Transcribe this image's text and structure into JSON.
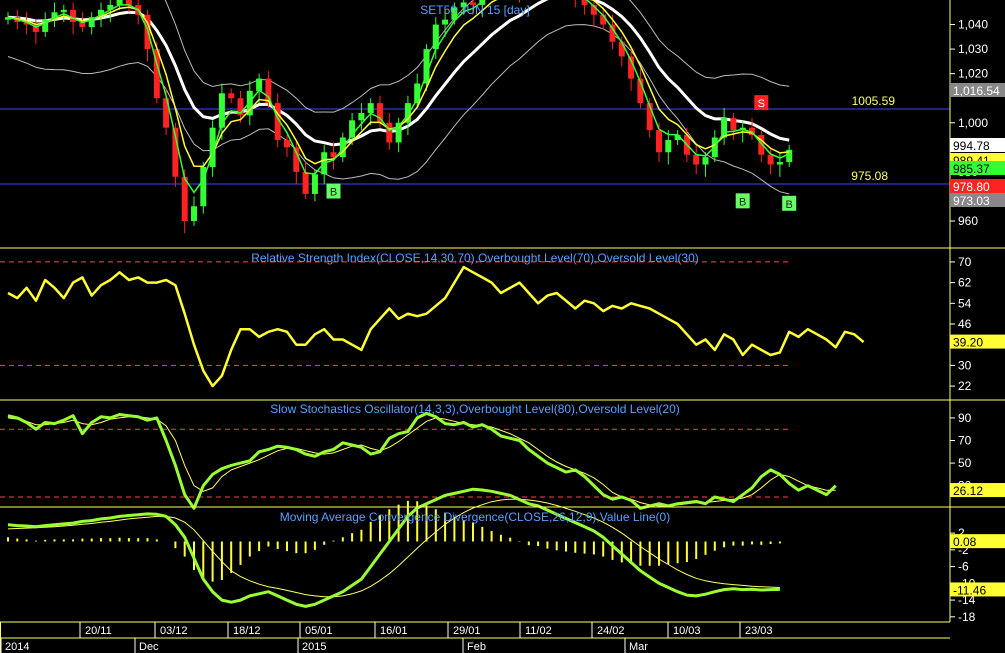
{
  "colors": {
    "background": "#000000",
    "frame": "#ffff66",
    "candle_up": "#33ff33",
    "candle_down": "#ff2222",
    "bollinger_mid": "#ffffff",
    "bollinger_band": "#bbbbbb",
    "ema_fast": "#33ff33",
    "ema_slow": "#ffff33",
    "level_line": "#4444ff",
    "overbought_oversold": "#ff4444",
    "rsi": "#ffff33",
    "stoch_k": "#99ff33",
    "stoch_d": "#ffff66",
    "macd": "#99ff33",
    "macd_signal": "#ffff66",
    "macd_hist": "#ffff33",
    "title_text": "#5aa0ff"
  },
  "chart_data": [
    {
      "type": "candlestick",
      "title": "SET50 JUN 15  [day]",
      "ylim": [
        949,
        1050
      ],
      "y_ticks": [
        960,
        980,
        1000,
        1020,
        1030,
        1040
      ],
      "y_tick_labels": [
        "960",
        "980",
        "1,000",
        "1,020",
        "1,030",
        "1,040"
      ],
      "close": [
        1043,
        1041,
        1040,
        1037,
        1042,
        1045,
        1046,
        1041,
        1039,
        1043,
        1046,
        1048,
        1050,
        1048,
        1044,
        1030,
        1010,
        998,
        978,
        960,
        966,
        982,
        998,
        1012,
        1010,
        1003,
        1013,
        1018,
        1008,
        993,
        990,
        980,
        971,
        979,
        988,
        986,
        994,
        1001,
        1004,
        1008,
        1000,
        992,
        1000,
        1008,
        1016,
        1030,
        1040,
        1042,
        1047,
        1049,
        1048,
        1052,
        1056,
        1055,
        1058,
        1054,
        1060,
        1062,
        1061,
        1056,
        1057,
        1050,
        1048,
        1044,
        1040,
        1033,
        1027,
        1018,
        1008,
        997,
        988,
        993,
        995,
        987,
        983,
        986,
        994,
        1002,
        997,
        998,
        995,
        987,
        983,
        984,
        989
      ],
      "levels": [
        {
          "value": 1005.59,
          "label": "1005.59"
        },
        {
          "value": 975.08,
          "label": "975.08"
        }
      ],
      "price_badges": [
        {
          "value": "1,016.54",
          "color": "#888888"
        },
        {
          "value": "994.78",
          "color": "#ffffff"
        },
        {
          "value": "989.41",
          "color": "#ffff33"
        },
        {
          "value": "985.37",
          "color": "#33ff33"
        },
        {
          "value": "978.80",
          "color": "#ff2222"
        },
        {
          "value": "973.03",
          "color": "#888888"
        }
      ],
      "signals": [
        {
          "label": "B",
          "kind": "buy",
          "bar": 35,
          "price": 972
        },
        {
          "label": "B",
          "kind": "buy",
          "bar": 79,
          "price": 968
        },
        {
          "label": "B",
          "kind": "buy",
          "bar": 84,
          "price": 967
        },
        {
          "label": "S",
          "kind": "sell",
          "bar": 81,
          "price": 1008
        }
      ]
    },
    {
      "type": "line",
      "title": "Relative Strength Index(CLOSE,14,30,70),Overbought Level(70),Oversold Level(30)",
      "ylim": [
        17,
        75
      ],
      "y_ticks": [
        70,
        62,
        54,
        46,
        38,
        30,
        22
      ],
      "overbought": 70,
      "oversold": 30,
      "current_value": "39.20",
      "series": [
        {
          "values": [
            58,
            56,
            60,
            55,
            63,
            60,
            56,
            62,
            64,
            57,
            61,
            63,
            66,
            63,
            64,
            62,
            62,
            63,
            61,
            50,
            38,
            28,
            22,
            26,
            36,
            44,
            44,
            41,
            43,
            44,
            43,
            38,
            38,
            42,
            44,
            40,
            40,
            38,
            36,
            44,
            48,
            52,
            48,
            50,
            49,
            50,
            53,
            56,
            62,
            68,
            66,
            64,
            62,
            58,
            60,
            62,
            58,
            54,
            57,
            58,
            55,
            52,
            55,
            54,
            51,
            53,
            52,
            54,
            53,
            52,
            50,
            48,
            46,
            42,
            38,
            40,
            36,
            42,
            40,
            34,
            38,
            36,
            34,
            35,
            43,
            41,
            44,
            42,
            40,
            37,
            43,
            42,
            39
          ]
        }
      ]
    },
    {
      "type": "line",
      "title": "Slow Stochastics Oscillator(14,3,3),Overbought Level(80),Oversold Level(20)",
      "ylim": [
        12,
        105
      ],
      "y_ticks": [
        90,
        70,
        50,
        30
      ],
      "overbought": 80,
      "oversold": 20,
      "current_value": "26.12",
      "series": [
        {
          "name": "%K",
          "values": [
            92,
            90,
            86,
            80,
            86,
            85,
            88,
            92,
            76,
            86,
            91,
            90,
            93,
            92,
            91,
            88,
            90,
            70,
            48,
            22,
            10,
            30,
            40,
            45,
            48,
            50,
            52,
            60,
            62,
            65,
            64,
            62,
            58,
            56,
            60,
            62,
            68,
            66,
            64,
            58,
            60,
            72,
            76,
            78,
            90,
            94,
            91,
            85,
            84,
            86,
            82,
            84,
            80,
            74,
            72,
            70,
            62,
            56,
            50,
            46,
            42,
            44,
            38,
            30,
            22,
            18,
            20,
            17,
            10,
            12,
            14,
            12,
            14,
            15,
            16,
            14,
            20,
            18,
            16,
            22,
            28,
            38,
            44,
            40,
            32,
            26,
            30,
            26,
            22,
            30
          ]
        },
        {
          "name": "%D",
          "values": [
            90,
            89,
            87,
            84,
            84,
            85,
            86,
            88,
            85,
            84,
            86,
            89,
            90,
            91,
            91,
            90,
            89,
            83,
            70,
            48,
            30,
            25,
            28,
            38,
            44,
            47,
            50,
            53,
            57,
            61,
            63,
            63,
            61,
            59,
            58,
            59,
            62,
            65,
            66,
            63,
            61,
            64,
            69,
            75,
            81,
            87,
            90,
            89,
            87,
            85,
            84,
            83,
            82,
            79,
            76,
            72,
            68,
            62,
            56,
            51,
            47,
            44,
            41,
            37,
            31,
            24,
            20,
            18,
            15,
            13,
            12,
            12,
            13,
            14,
            15,
            15,
            16,
            17,
            18,
            19,
            22,
            28,
            35,
            40,
            38,
            34,
            30,
            28,
            26,
            26
          ]
        }
      ]
    },
    {
      "type": "bar",
      "title": "Moving Average Convergence Divergence(CLOSE,26,12,9),Value Line(0)",
      "ylim": [
        -19,
        8
      ],
      "y_ticks": [
        2,
        -2,
        -6,
        -10,
        -14,
        -18
      ],
      "current_values": [
        "0.08",
        "-11.46"
      ],
      "series": [
        {
          "name": "MACD",
          "values": [
            4,
            3.8,
            3.7,
            3.5,
            3.8,
            4,
            4.2,
            4.4,
            4.8,
            5,
            5.4,
            5.6,
            6,
            6.2,
            6.4,
            6.6,
            6.5,
            6,
            4,
            1,
            -4,
            -9,
            -12,
            -14,
            -14.5,
            -14,
            -13,
            -12.5,
            -12,
            -13,
            -14,
            -15,
            -15.5,
            -15,
            -14,
            -13,
            -12,
            -10.5,
            -9,
            -6,
            -3,
            0,
            3,
            6,
            8,
            9,
            10,
            11,
            11.5,
            12,
            12.5,
            12.3,
            12,
            11.5,
            11,
            10,
            9,
            8.5,
            7.5,
            6.5,
            5.5,
            4.5,
            3.5,
            2.5,
            1,
            -1,
            -3,
            -5,
            -7,
            -8.5,
            -10,
            -11,
            -12,
            -12.8,
            -13,
            -12.6,
            -12,
            -11.5,
            -11.3,
            -11.5,
            -11.4,
            -11.6,
            -11.5,
            -11.46
          ]
        },
        {
          "name": "Signal",
          "values": [
            3,
            3.1,
            3.2,
            3.3,
            3.4,
            3.5,
            3.7,
            3.9,
            4.1,
            4.3,
            4.6,
            4.8,
            5.1,
            5.4,
            5.6,
            5.8,
            6,
            6,
            5.6,
            4.6,
            2.8,
            0.2,
            -2.4,
            -4.8,
            -7,
            -8.4,
            -9.4,
            -10.2,
            -10.8,
            -11.2,
            -11.7,
            -12.2,
            -12.7,
            -13,
            -13.2,
            -13.2,
            -13,
            -12.5,
            -11.8,
            -10.7,
            -9.3,
            -7.7,
            -5.8,
            -3.7,
            -1.6,
            0.4,
            2.3,
            4.1,
            5.6,
            6.9,
            8,
            8.8,
            9.5,
            9.9,
            10.1,
            10.1,
            9.9,
            9.6,
            9.2,
            8.6,
            7.9,
            7.2,
            6.4,
            5.6,
            4.6,
            3.4,
            2,
            0.4,
            -1.2,
            -2.7,
            -4.2,
            -5.5,
            -6.8,
            -7.9,
            -8.8,
            -9.4,
            -9.8,
            -10.1,
            -10.3,
            -10.5,
            -10.7,
            -10.8,
            -10.9,
            -11
          ]
        },
        {
          "name": "Histogram",
          "values": [
            1,
            0.7,
            0.5,
            0.2,
            0.4,
            0.5,
            0.5,
            0.5,
            0.7,
            0.7,
            0.8,
            0.8,
            0.9,
            0.8,
            0.8,
            0.8,
            0.5,
            0,
            -1.6,
            -3.6,
            -6.8,
            -9.2,
            -9.6,
            -9.2,
            -7.5,
            -5.6,
            -3.6,
            -2.3,
            -1.2,
            -1.8,
            -2.3,
            -2.8,
            -2.8,
            -2,
            -0.8,
            0.2,
            1,
            2,
            2.8,
            4.7,
            6.3,
            7.7,
            8.8,
            9.7,
            9.6,
            8.6,
            7.7,
            6.9,
            5.9,
            5.1,
            4.5,
            3.5,
            2.5,
            1.6,
            0.9,
            -0.1,
            -0.9,
            -1.1,
            -1.7,
            -2.1,
            -2.4,
            -2.7,
            -2.9,
            -3.1,
            -3.6,
            -4.4,
            -5,
            -5.4,
            -5.8,
            -5.8,
            -5.8,
            -5.5,
            -5.2,
            -4.9,
            -4.2,
            -3.2,
            -2.2,
            -1.4,
            -1,
            -1,
            -0.7,
            -0.8,
            -0.6,
            -0.46
          ]
        }
      ]
    }
  ],
  "x_axis": {
    "ticks": [
      "20/11",
      "03/12",
      "18/12",
      "05/01",
      "16/01",
      "29/01",
      "11/02",
      "24/02",
      "10/03",
      "23/03"
    ],
    "periods": [
      "2014",
      "Dec",
      "2015",
      "Feb",
      "Mar"
    ]
  }
}
